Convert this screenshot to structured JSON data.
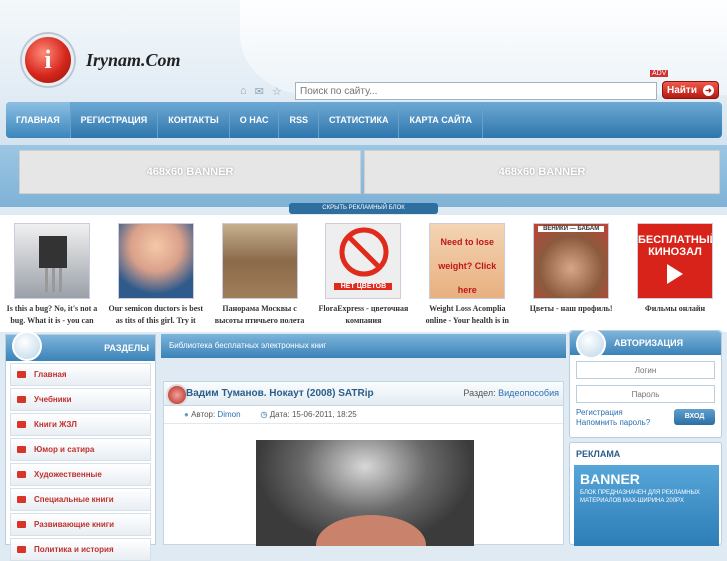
{
  "site": {
    "logo_letter": "i",
    "name": "Irynam.Com"
  },
  "search": {
    "placeholder": "Поиск по сайту...",
    "button": "Найти",
    "adv_label": "ADV"
  },
  "nav": [
    "ГЛАВНАЯ",
    "РЕГИСТРАЦИЯ",
    "КОНТАКТЫ",
    "О НАС",
    "RSS",
    "СТАТИСТИКА",
    "КАРТА САЙТА"
  ],
  "banners": {
    "left": "468x60 BANNER",
    "right": "468x60 BANNER",
    "hide_label": "СКРЫТЬ РЕКЛАМНЫЙ БЛОК"
  },
  "ads": [
    {
      "caption": "Is this a bug? No, it's not a bug. What it is - you can",
      "img_text": "",
      "color": "#c9cdd2"
    },
    {
      "caption": "Our semicon ductors is best as tits of this girl. Try it",
      "img_text": "",
      "color": "#d9a08a"
    },
    {
      "caption": "Панорама Москвы с высоты птичьего полета",
      "img_text": "",
      "color": "#a57a5a"
    },
    {
      "caption": "FloraExpress - цветочная компания",
      "img_text": "НЕТ ЦВЕТОВ",
      "color": "#eeeeee"
    },
    {
      "caption": "Weight Loss Acomplia online - Your health is in",
      "img_text": "Need to lose weight? Click here",
      "color": "#e8b07f"
    },
    {
      "caption": "Цветы - наш профиль!",
      "img_text": "ВЕНИКИ — БАБАМ",
      "color": "#b5a17a"
    },
    {
      "caption": "Фильмы онлайн",
      "img_text": "БЕСПЛАТНЫЙ КИНОЗАЛ",
      "color": "#d8231a"
    }
  ],
  "sidebar": {
    "title": "РАЗДЕЛЫ",
    "items": [
      "Главная",
      "Учебники",
      "Книги ЖЗЛ",
      "Юмор и сатира",
      "Художественные",
      "Специальные книги",
      "Развивающие книги",
      "Политика и история"
    ]
  },
  "main": {
    "heading": "Библиотека бесплатных электронных книг",
    "post": {
      "title": "Вадим Туманов. Нокаут (2008) SATRip",
      "category_label": "Раздел:",
      "category": "Видеопособия",
      "author_label": "Автор:",
      "author": "Dimon",
      "date_label": "Дата:",
      "date": "15-06-2011, 18:25"
    }
  },
  "auth": {
    "title": "АВТОРИЗАЦИЯ",
    "login_placeholder": "Логин",
    "password_placeholder": "Пароль",
    "register_link": "Регистрация",
    "remind_link": "Напомнить пароль?",
    "login_button": "ВХОД"
  },
  "ads_box": {
    "title": "РЕКЛАМА",
    "banner_title": "BANNER",
    "banner_text": "БЛОК ПРЕДНАЗНАЧЕН ДЛЯ РЕКЛАМНЫХ МАТЕРИАЛОВ MAX-ШИРИНА 200PX"
  }
}
